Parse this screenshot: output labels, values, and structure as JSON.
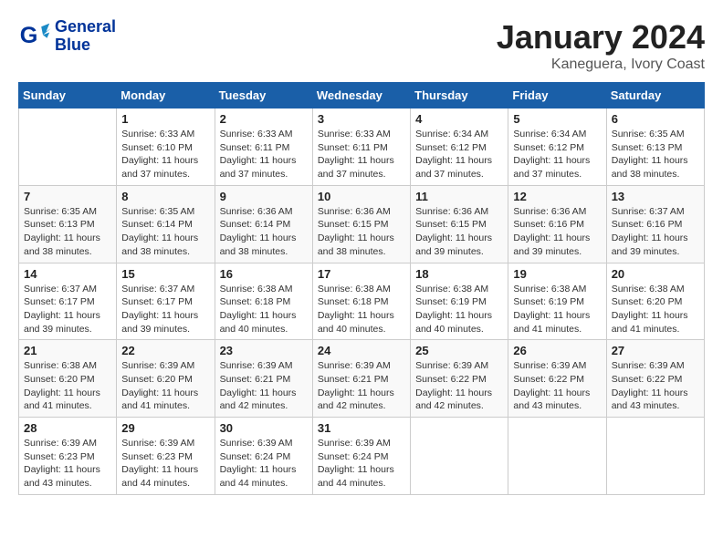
{
  "header": {
    "logo_line1": "General",
    "logo_line2": "Blue",
    "title": "January 2024",
    "subtitle": "Kaneguera, Ivory Coast"
  },
  "days_of_week": [
    "Sunday",
    "Monday",
    "Tuesday",
    "Wednesday",
    "Thursday",
    "Friday",
    "Saturday"
  ],
  "weeks": [
    [
      {
        "day": "",
        "info": ""
      },
      {
        "day": "1",
        "info": "Sunrise: 6:33 AM\nSunset: 6:10 PM\nDaylight: 11 hours\nand 37 minutes."
      },
      {
        "day": "2",
        "info": "Sunrise: 6:33 AM\nSunset: 6:11 PM\nDaylight: 11 hours\nand 37 minutes."
      },
      {
        "day": "3",
        "info": "Sunrise: 6:33 AM\nSunset: 6:11 PM\nDaylight: 11 hours\nand 37 minutes."
      },
      {
        "day": "4",
        "info": "Sunrise: 6:34 AM\nSunset: 6:12 PM\nDaylight: 11 hours\nand 37 minutes."
      },
      {
        "day": "5",
        "info": "Sunrise: 6:34 AM\nSunset: 6:12 PM\nDaylight: 11 hours\nand 37 minutes."
      },
      {
        "day": "6",
        "info": "Sunrise: 6:35 AM\nSunset: 6:13 PM\nDaylight: 11 hours\nand 38 minutes."
      }
    ],
    [
      {
        "day": "7",
        "info": "Sunrise: 6:35 AM\nSunset: 6:13 PM\nDaylight: 11 hours\nand 38 minutes."
      },
      {
        "day": "8",
        "info": "Sunrise: 6:35 AM\nSunset: 6:14 PM\nDaylight: 11 hours\nand 38 minutes."
      },
      {
        "day": "9",
        "info": "Sunrise: 6:36 AM\nSunset: 6:14 PM\nDaylight: 11 hours\nand 38 minutes."
      },
      {
        "day": "10",
        "info": "Sunrise: 6:36 AM\nSunset: 6:15 PM\nDaylight: 11 hours\nand 38 minutes."
      },
      {
        "day": "11",
        "info": "Sunrise: 6:36 AM\nSunset: 6:15 PM\nDaylight: 11 hours\nand 39 minutes."
      },
      {
        "day": "12",
        "info": "Sunrise: 6:36 AM\nSunset: 6:16 PM\nDaylight: 11 hours\nand 39 minutes."
      },
      {
        "day": "13",
        "info": "Sunrise: 6:37 AM\nSunset: 6:16 PM\nDaylight: 11 hours\nand 39 minutes."
      }
    ],
    [
      {
        "day": "14",
        "info": "Sunrise: 6:37 AM\nSunset: 6:17 PM\nDaylight: 11 hours\nand 39 minutes."
      },
      {
        "day": "15",
        "info": "Sunrise: 6:37 AM\nSunset: 6:17 PM\nDaylight: 11 hours\nand 39 minutes."
      },
      {
        "day": "16",
        "info": "Sunrise: 6:38 AM\nSunset: 6:18 PM\nDaylight: 11 hours\nand 40 minutes."
      },
      {
        "day": "17",
        "info": "Sunrise: 6:38 AM\nSunset: 6:18 PM\nDaylight: 11 hours\nand 40 minutes."
      },
      {
        "day": "18",
        "info": "Sunrise: 6:38 AM\nSunset: 6:19 PM\nDaylight: 11 hours\nand 40 minutes."
      },
      {
        "day": "19",
        "info": "Sunrise: 6:38 AM\nSunset: 6:19 PM\nDaylight: 11 hours\nand 41 minutes."
      },
      {
        "day": "20",
        "info": "Sunrise: 6:38 AM\nSunset: 6:20 PM\nDaylight: 11 hours\nand 41 minutes."
      }
    ],
    [
      {
        "day": "21",
        "info": "Sunrise: 6:38 AM\nSunset: 6:20 PM\nDaylight: 11 hours\nand 41 minutes."
      },
      {
        "day": "22",
        "info": "Sunrise: 6:39 AM\nSunset: 6:20 PM\nDaylight: 11 hours\nand 41 minutes."
      },
      {
        "day": "23",
        "info": "Sunrise: 6:39 AM\nSunset: 6:21 PM\nDaylight: 11 hours\nand 42 minutes."
      },
      {
        "day": "24",
        "info": "Sunrise: 6:39 AM\nSunset: 6:21 PM\nDaylight: 11 hours\nand 42 minutes."
      },
      {
        "day": "25",
        "info": "Sunrise: 6:39 AM\nSunset: 6:22 PM\nDaylight: 11 hours\nand 42 minutes."
      },
      {
        "day": "26",
        "info": "Sunrise: 6:39 AM\nSunset: 6:22 PM\nDaylight: 11 hours\nand 43 minutes."
      },
      {
        "day": "27",
        "info": "Sunrise: 6:39 AM\nSunset: 6:22 PM\nDaylight: 11 hours\nand 43 minutes."
      }
    ],
    [
      {
        "day": "28",
        "info": "Sunrise: 6:39 AM\nSunset: 6:23 PM\nDaylight: 11 hours\nand 43 minutes."
      },
      {
        "day": "29",
        "info": "Sunrise: 6:39 AM\nSunset: 6:23 PM\nDaylight: 11 hours\nand 44 minutes."
      },
      {
        "day": "30",
        "info": "Sunrise: 6:39 AM\nSunset: 6:24 PM\nDaylight: 11 hours\nand 44 minutes."
      },
      {
        "day": "31",
        "info": "Sunrise: 6:39 AM\nSunset: 6:24 PM\nDaylight: 11 hours\nand 44 minutes."
      },
      {
        "day": "",
        "info": ""
      },
      {
        "day": "",
        "info": ""
      },
      {
        "day": "",
        "info": ""
      }
    ]
  ]
}
